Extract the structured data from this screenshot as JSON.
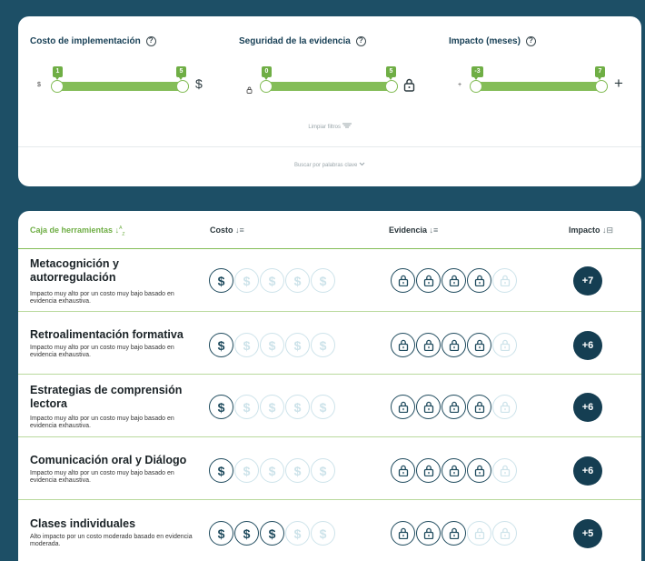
{
  "filters": {
    "cost": {
      "title": "Costo de implementación",
      "min_label": "1",
      "max_label": "5",
      "low_symbol": "$",
      "high_symbol": "$"
    },
    "evidence": {
      "title": "Seguridad de la evidencia",
      "min_label": "0",
      "max_label": "5",
      "low_icon": "small-lock-icon",
      "high_icon": "lock-icon"
    },
    "impact": {
      "title": "Impacto (meses)",
      "min_label": "-3",
      "max_label": "7",
      "low_symbol": "+",
      "high_symbol": "+"
    },
    "clear_label": "Limpiar filtros",
    "keyword_label": "Buscar por palabras clave"
  },
  "table": {
    "headers": {
      "toolbox": "Caja de herramientas",
      "cost": "Costo",
      "evidence": "Evidencia",
      "impact": "Impacto"
    },
    "rows": [
      {
        "title": "Metacognición y autorregulación",
        "desc": "Impacto muy alto por un costo muy bajo basado en evidencia exhaustiva.",
        "cost": 1,
        "evidence": 4,
        "impact": "+7"
      },
      {
        "title": "Retroalimentación formativa",
        "desc": "Impacto muy alto por un costo muy bajo basado en evidencia exhaustiva.",
        "cost": 1,
        "evidence": 4,
        "impact": "+6"
      },
      {
        "title": "Estrategias de comprensión lectora",
        "desc": "Impacto muy alto por un costo muy bajo basado en evidencia exhaustiva.",
        "cost": 1,
        "evidence": 4,
        "impact": "+6"
      },
      {
        "title": "Comunicación oral y Diálogo",
        "desc": "Impacto muy alto por un costo muy bajo basado en evidencia exhaustiva.",
        "cost": 1,
        "evidence": 4,
        "impact": "+6"
      },
      {
        "title": "Clases individuales",
        "desc": "Alto impacto por un costo moderado basado en evidencia moderada.",
        "cost": 3,
        "evidence": 3,
        "impact": "+5"
      }
    ]
  },
  "colors": {
    "accent": "#84bd58",
    "dark": "#153e52",
    "icon_on": "#1f4b5e",
    "icon_off": "#cde3ea"
  }
}
